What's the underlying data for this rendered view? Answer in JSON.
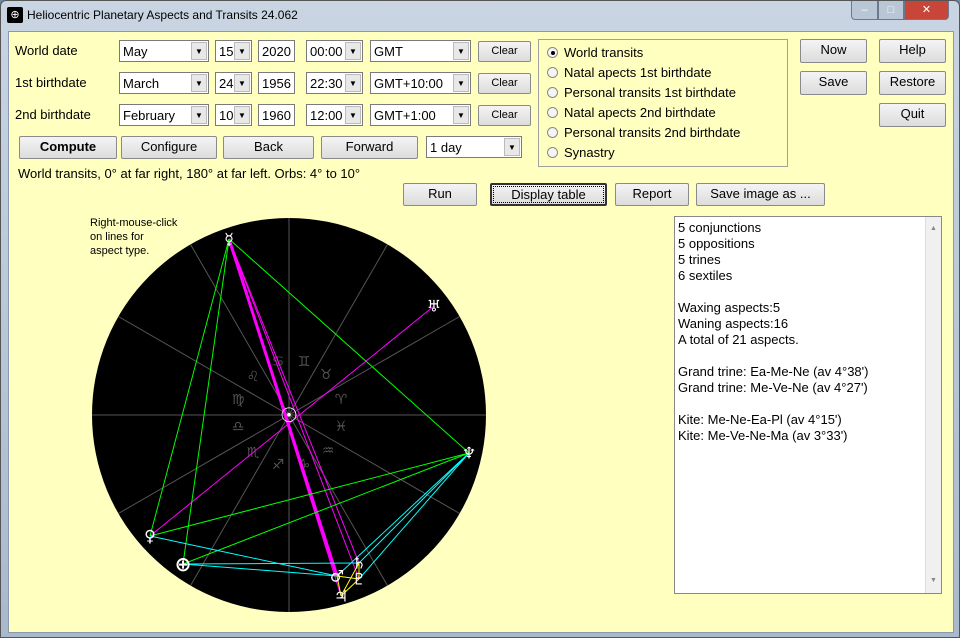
{
  "window": {
    "title": "Heliocentric Planetary Aspects and Transits 24.062",
    "minimize": "‒",
    "maximize": "□",
    "close": "✕"
  },
  "rows": [
    {
      "label": "World date",
      "month": "May",
      "day": "15",
      "year": "2020",
      "time": "00:00",
      "tz": "GMT",
      "clear": "Clear"
    },
    {
      "label": "1st birthdate",
      "month": "March",
      "day": "24",
      "year": "1956",
      "time": "22:30",
      "tz": "GMT+10:00",
      "clear": "Clear"
    },
    {
      "label": "2nd birthdate",
      "month": "February",
      "day": "10",
      "year": "1960",
      "time": "12:00",
      "tz": "GMT+1:00",
      "clear": "Clear"
    }
  ],
  "actions": {
    "compute": "Compute",
    "configure": "Configure",
    "back": "Back",
    "forward": "Forward",
    "step": "1 day"
  },
  "status": "World transits, 0° at far right, 180° at far left.  Orbs: 4° to 10°",
  "modes": [
    {
      "label": "World transits",
      "selected": true
    },
    {
      "label": "Natal apects 1st birthdate",
      "selected": false
    },
    {
      "label": "Personal transits 1st birthdate",
      "selected": false
    },
    {
      "label": "Natal apects 2nd birthdate",
      "selected": false
    },
    {
      "label": "Personal transits 2nd birthdate",
      "selected": false
    },
    {
      "label": "Synastry",
      "selected": false
    }
  ],
  "side": {
    "now": "Now",
    "help": "Help",
    "save": "Save",
    "restore": "Restore",
    "quit": "Quit"
  },
  "toolbar": {
    "run": "Run",
    "display_table": "Display table",
    "report": "Report",
    "save_image": "Save image as ..."
  },
  "chart_hint": [
    "Right-mouse-click",
    "on lines for",
    "aspect type."
  ],
  "zodiac": [
    "♈",
    "♉",
    "♊",
    "♋",
    "♌",
    "♍",
    "♎",
    "♏",
    "♐",
    "♑",
    "♒",
    "♓"
  ],
  "planets": {
    "sun": "☉",
    "mercury": "☿",
    "venus": "♀",
    "earth": "⊕",
    "mars": "♂",
    "jupiter": "♃",
    "saturn": "♄",
    "uranus": "♅",
    "neptune": "♆",
    "pluto": "♇"
  },
  "aspect_colors": {
    "conjunction": "#ffff00",
    "opposition": "#ff00ff",
    "trine": "#00ff00",
    "sextile": "#00ffff"
  },
  "report_lines": [
    "5 conjunctions",
    "5 oppositions",
    "5 trines",
    "6 sextiles",
    "",
    "Waxing aspects:5",
    "Waning aspects:16",
    "A total of 21 aspects.",
    "",
    "Grand trine: Ea-Me-Ne (av 4°38')",
    "Grand trine: Me-Ve-Ne (av 4°27')",
    "",
    "Kite: Me-Ne-Ea-Pl (av 4°15')",
    "Kite: Me-Ve-Ne-Ma (av 3°33')"
  ]
}
